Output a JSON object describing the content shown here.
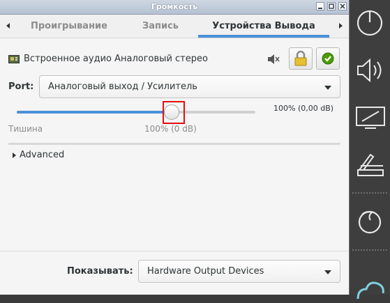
{
  "window": {
    "title": "Громкость"
  },
  "tabs": {
    "items": [
      {
        "label": "Проигрывание",
        "active": false
      },
      {
        "label": "Запись",
        "active": false
      },
      {
        "label": "Устройства Вывода",
        "active": true
      }
    ]
  },
  "device": {
    "name": "Встроенное аудио Аналоговый стерео",
    "port_label": "Port:",
    "port_value": "Аналоговый выход / Усилитель",
    "volume_readout": "100% (0,00 dB)",
    "volume_fraction": 0.65,
    "mark_silence": "Тишина",
    "mark_100": "100% (0 dB)"
  },
  "advanced": {
    "label": "Advanced"
  },
  "footer": {
    "show_label": "Показывать:",
    "show_value": "Hardware Output Devices"
  },
  "colors": {
    "accent": "#4a90d9",
    "highlight": "#e01010",
    "dock": "#3e3e3e"
  },
  "dock_icons": [
    "power-icon",
    "speaker-icon",
    "display-icon",
    "scanner-icon",
    "firefox-icon",
    "cloud-icon"
  ]
}
